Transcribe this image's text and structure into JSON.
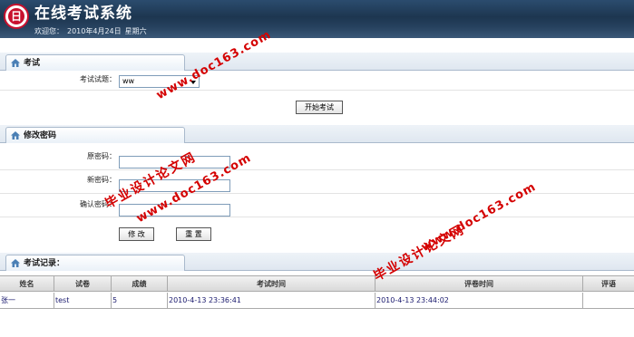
{
  "header": {
    "logo_glyph": "日",
    "app_title": "在线考试系统",
    "welcome_label": "欢迎您：",
    "date": "2010年4月24日",
    "weekday": "星期六"
  },
  "exam_section": {
    "title": "考试",
    "paper_label": "考试试题：",
    "paper_selected": "ww",
    "start_button": "开始考试"
  },
  "password_section": {
    "title": "修改密码",
    "old_password_label": "原密码：",
    "new_password_label": "新密码：",
    "confirm_password_label": "确认密码：",
    "modify_button": "修  改",
    "reset_button": "重  置"
  },
  "records_section": {
    "title": "考试记录：",
    "columns": [
      "姓名",
      "试卷",
      "成绩",
      "考试时间",
      "评卷时间",
      "评语"
    ],
    "rows": [
      [
        "张一",
        "test",
        "5",
        "2010-4-13 23:36:41",
        "2010-4-13 23:44:02",
        ""
      ]
    ]
  },
  "watermark": {
    "site": "www.doc163.com",
    "name": "毕业设计论文网",
    "color": "#d40000"
  },
  "colors": {
    "header_bg": "#1d3650",
    "border": "#a9b9cc"
  }
}
